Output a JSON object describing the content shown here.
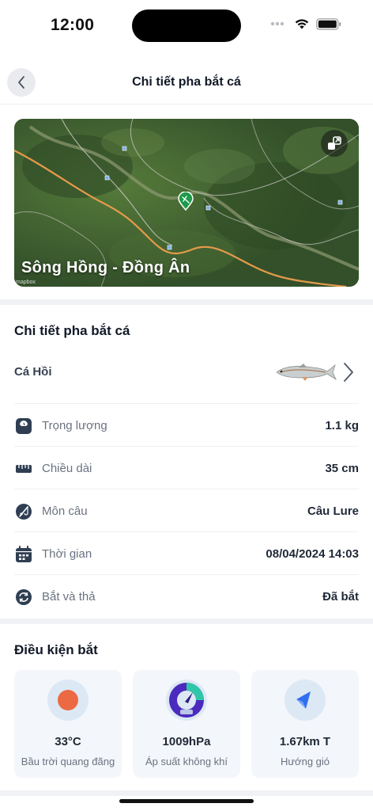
{
  "status_bar": {
    "time": "12:00"
  },
  "nav": {
    "title": "Chi tiết pha bắt cá"
  },
  "map": {
    "location_label": "Sông Hồng - Đồng Ân",
    "attribution": "mapbox"
  },
  "catch_details": {
    "section_title": "Chi tiết pha bắt cá",
    "species": "Cá Hồi",
    "rows": [
      {
        "icon": "weight-scale-icon",
        "label": "Trọng lượng",
        "value": "1.1 kg"
      },
      {
        "icon": "ruler-icon",
        "label": "Chiều dài",
        "value": "35 cm"
      },
      {
        "icon": "fishing-rod-icon",
        "label": "Môn câu",
        "value": "Câu Lure"
      },
      {
        "icon": "calendar-icon",
        "label": "Thời gian",
        "value": "08/04/2024 14:03"
      },
      {
        "icon": "catch-release-icon",
        "label": "Bắt và thả",
        "value": "Đã bắt"
      }
    ]
  },
  "conditions": {
    "section_title": "Điều kiện bắt",
    "cards": [
      {
        "icon": "sun-icon",
        "value": "33°C",
        "label": "Bầu trời quang đãng"
      },
      {
        "icon": "pressure-gauge-icon",
        "value": "1009hPa",
        "label": "Áp suất không khí"
      },
      {
        "icon": "wind-direction-icon",
        "value": "1.67km T",
        "label": "Hướng gió"
      }
    ]
  },
  "colors": {
    "accent_green": "#1e9a4a",
    "sun_orange": "#ec6a43",
    "wind_blue": "#2f6ff0",
    "gauge_purple": "#4b2bbd",
    "card_bg": "#f3f6fa"
  }
}
